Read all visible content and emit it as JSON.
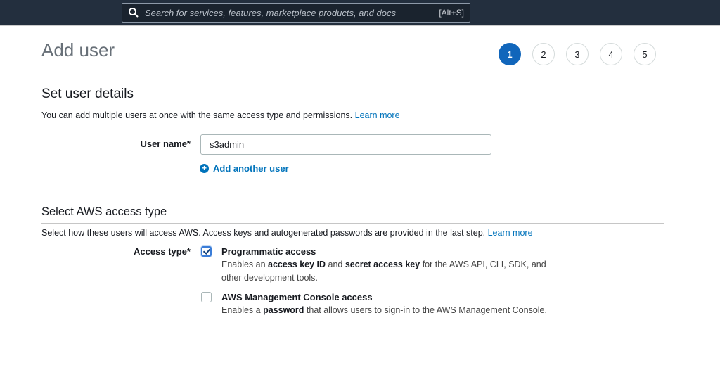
{
  "topbar": {
    "search_placeholder": "Search for services, features, marketplace products, and docs",
    "shortcut": "[Alt+S]"
  },
  "page_title": "Add user",
  "steps": [
    "1",
    "2",
    "3",
    "4",
    "5"
  ],
  "active_step": 1,
  "details": {
    "heading": "Set user details",
    "description": "You can add multiple users at once with the same access type and permissions.",
    "learn_more": "Learn more",
    "user_name_label": "User name*",
    "user_name_value": "s3admin",
    "add_another": "Add another user"
  },
  "access": {
    "heading": "Select AWS access type",
    "description": "Select how these users will access AWS. Access keys and autogenerated passwords are provided in the last step.",
    "learn_more": "Learn more",
    "label": "Access type*",
    "options": [
      {
        "title": "Programmatic access",
        "checked": true,
        "desc": [
          {
            "t": "Enables an "
          },
          {
            "b": "access key ID"
          },
          {
            "t": " and "
          },
          {
            "b": "secret access key"
          },
          {
            "t": " for the AWS API, CLI, SDK, and other development tools."
          }
        ]
      },
      {
        "title": "AWS Management Console access",
        "checked": false,
        "desc": [
          {
            "t": "Enables a "
          },
          {
            "b": "password"
          },
          {
            "t": " that allows users to sign-in to the AWS Management Console."
          }
        ]
      }
    ]
  }
}
